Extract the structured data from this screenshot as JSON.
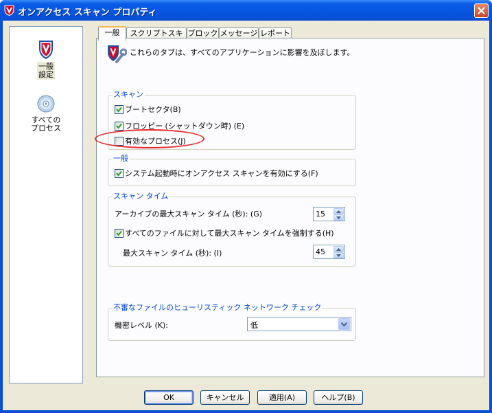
{
  "window": {
    "title": "オンアクセス スキャン プロパティ"
  },
  "sidebar": {
    "items": [
      {
        "label_line1": "一般",
        "label_line2": "設定",
        "icon": "mcafee-shield-icon",
        "selected": true
      },
      {
        "label_line1": "すべての",
        "label_line2": "プロセス",
        "icon": "disc-icon",
        "selected": false
      }
    ]
  },
  "tabs": [
    {
      "label": "一般",
      "active": true
    },
    {
      "label": "スクリプトスキャン",
      "active": false
    },
    {
      "label": "ブロック",
      "active": false
    },
    {
      "label": "メッセージ",
      "active": false
    },
    {
      "label": "レポート",
      "active": false
    }
  ],
  "header": {
    "text": "これらのタブは、すべてのアプリケーションに影響を及ぼします。",
    "icon": "shield-wrench-icon"
  },
  "scan_group": {
    "title": "スキャン",
    "boot_sector": {
      "label": "ブートセクタ(B)",
      "checked": true
    },
    "floppy": {
      "label": "フロッピー (シャットダウン時) (E)",
      "checked": true
    },
    "enabled_process": {
      "label": "有効なプロセス(J)",
      "checked": false
    }
  },
  "general_group": {
    "title": "一般",
    "startup": {
      "label": "システム起動時にオンアクセス スキャンを有効にする(F)",
      "checked": true
    }
  },
  "scan_time_group": {
    "title": "スキャン タイム",
    "archive_label": "アーカイブの最大スキャン タイム (秒): (G)",
    "archive_value": "15",
    "enforce": {
      "label": "すべてのファイルに対して最大スキャン タイムを強制する(H)",
      "checked": true
    },
    "max_label": "最大スキャン タイム (秒): (I)",
    "max_value": "45"
  },
  "heuristic_group": {
    "title": "不審なファイルのヒューリスティック ネットワーク チェック",
    "sensitivity_label": "機密レベル (K):",
    "sensitivity_value": "低"
  },
  "buttons": {
    "ok": "OK",
    "cancel": "キャンセル",
    "apply": "適用(A)",
    "help": "ヘルプ(B)"
  },
  "colors": {
    "titlebar": "#0654e0",
    "group_title": "#0046d5",
    "highlight_ring": "#e8262a"
  }
}
